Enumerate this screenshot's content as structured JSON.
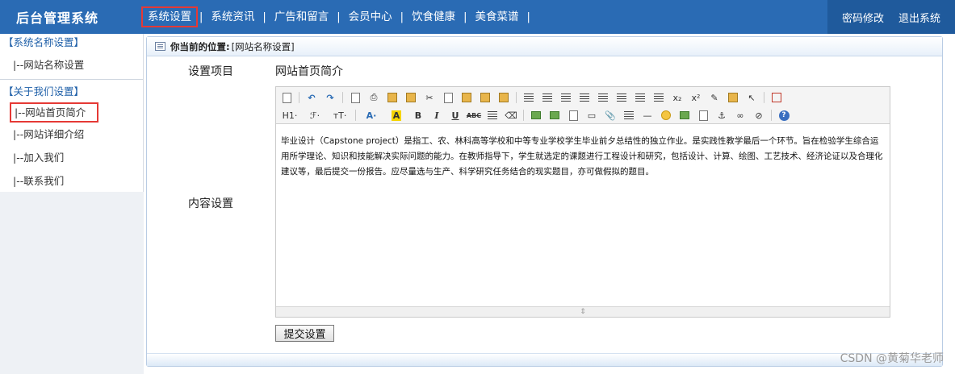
{
  "header": {
    "brand": "后台管理系统",
    "nav": [
      "系统设置",
      "系统资讯",
      "广告和留言",
      "会员中心",
      "饮食健康",
      "美食菜谱"
    ],
    "separator": "|",
    "right_links": [
      "密码修改",
      "退出系统"
    ]
  },
  "sidebar": {
    "group1": "【系统名称设置】",
    "group1_items": [
      "|--网站名称设置"
    ],
    "group2": "【关于我们设置】",
    "group2_items": [
      "|--网站首页简介",
      "|--网站详细介绍",
      "|--加入我们",
      "|--联系我们"
    ]
  },
  "breadcrumb": {
    "prefix": "你当前的位置:",
    "current": "[网站名称设置]"
  },
  "form": {
    "item_label": "设置项目",
    "item_value": "网站首页简介",
    "content_label": "内容设置",
    "content_text": "毕业设计（Capstone project）是指工、农、林科高等学校和中等专业学校学生毕业前夕总结性的独立作业。是实践性教学最后一个环节。旨在检验学生综合运用所学理论、知识和技能解决实际问题的能力。在教师指导下，学生就选定的课题进行工程设计和研究，包括设计、计算、绘图、工艺技术、经济论证以及合理化建议等，最后提交一份报告。应尽量选与生产、科学研究任务结合的现实题目，亦可做假拟的题目。",
    "submit_label": "提交设置"
  },
  "toolbar_labels": {
    "h1": "H1·",
    "font": "ℱ·",
    "size": "тT·",
    "fontcolor": "A·",
    "highlight": "A",
    "bold": "B",
    "italic": "I",
    "underline": "U",
    "strike": "ABC",
    "sub": "x₂",
    "sup": "x²",
    "help": "?"
  },
  "watermark": "CSDN @黄菊华老师",
  "colors": {
    "header_bg": "#2a6bb4",
    "header_right_bg": "#1f5a9c",
    "active_outline": "#e53935",
    "sidebar_group": "#1e5fa8"
  }
}
